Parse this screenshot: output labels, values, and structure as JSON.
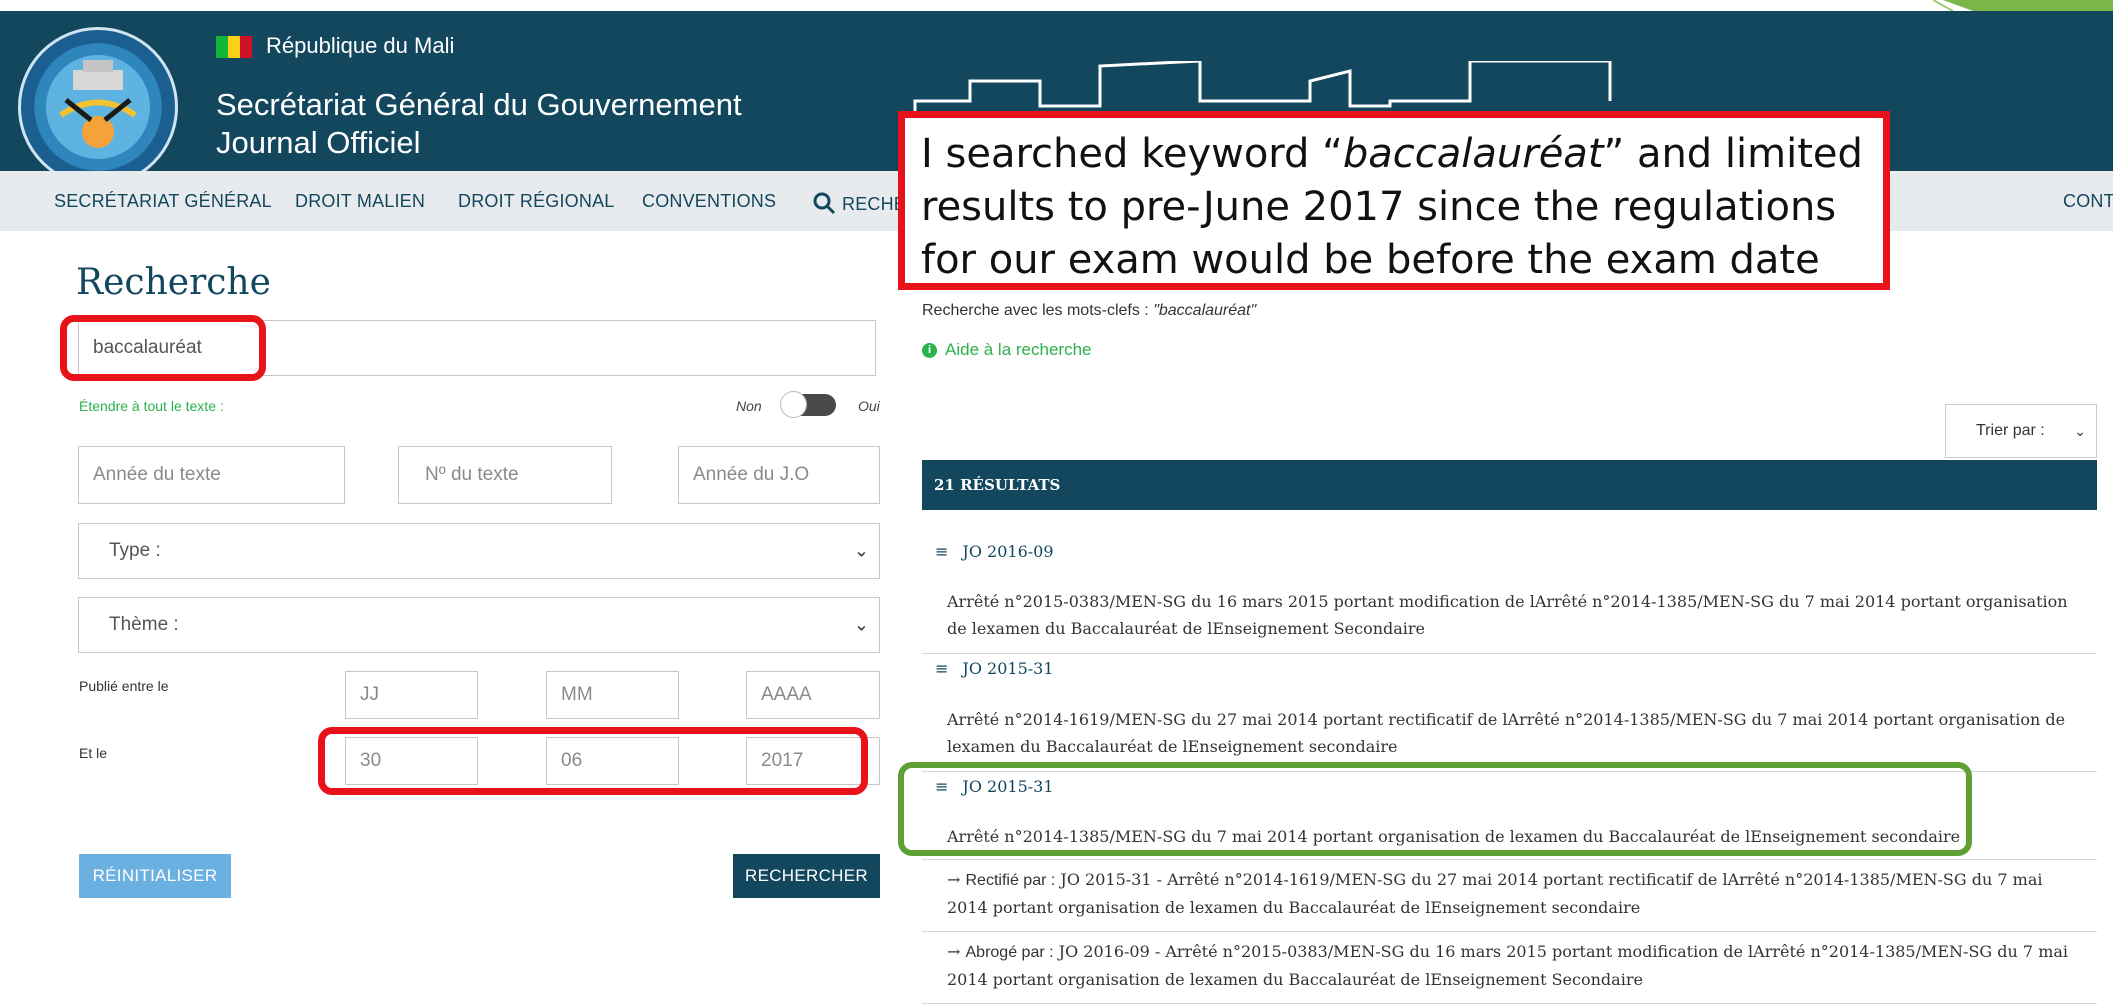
{
  "header": {
    "country": "République du Mali",
    "sgg": "Secrétariat Général du Gouvernement",
    "journal": "Journal Officiel",
    "flag_colors": [
      "#14b53a",
      "#fcd116",
      "#ce1126"
    ]
  },
  "nav": {
    "items": [
      "SECRÉTARIAT GÉNÉRAL",
      "DROIT MALIEN",
      "DROIT RÉGIONAL",
      "CONVENTIONS",
      "RECHE",
      "CONT"
    ],
    "search_icon": "search-icon"
  },
  "search": {
    "title": "Recherche",
    "keyword": "baccalauréat",
    "extend_label": "Étendre à tout le texte :",
    "toggle_off": "Non",
    "toggle_on": "Oui",
    "year_text_placeholder": "Année du texte",
    "num_text_placeholder": "Nº du texte",
    "year_jo_placeholder": "Année du J.O",
    "type_label": "Type :",
    "theme_label": "Thème :",
    "published_between": "Publié entre le",
    "and_label": "Et le",
    "day_placeholder": "JJ",
    "month_placeholder": "MM",
    "year_placeholder": "AAAA",
    "end_day": "30",
    "end_month": "06",
    "end_year": "2017",
    "reset_label": "RÉINITIALISER",
    "search_label": "RECHERCHER"
  },
  "callout": {
    "text_before": "I searched keyword “",
    "text_italic": "baccalauréat",
    "text_after": "” and limited results to pre-June 2017 since the regulations for our exam would be before the exam date"
  },
  "results": {
    "query_label": "Recherche avec les mots-clefs :",
    "query_value": "\"baccalauréat\"",
    "help_label": "Aide à la recherche",
    "sort_label": "Trier par :",
    "count_label": "21 RÉSULTATS",
    "items": [
      {
        "jo": "JO 2016-09",
        "text": "Arrêté n°2015-0383/MEN-SG du 16 mars 2015 portant modification de lArrêté n°2014-1385/MEN-SG du 7 mai 2014 portant organisation de lexamen du Baccalauréat de lEnseignement Secondaire"
      },
      {
        "jo": "JO 2015-31",
        "text": "Arrêté n°2014-1619/MEN-SG du 27 mai 2014 portant rectificatif de lArrêté n°2014-1385/MEN-SG du 7 mai 2014 portant organisation de lexamen du Baccalauréat de lEnseignement secondaire"
      },
      {
        "jo": "JO 2015-31",
        "text": "Arrêté n°2014-1385/MEN-SG du 7 mai 2014 portant organisation de lexamen du Baccalauréat de lEnseignement secondaire"
      }
    ],
    "relations": [
      {
        "label": "Rectifié par :",
        "text": "JO 2015-31 - Arrêté n°2014-1619/MEN-SG du 27 mai 2014 portant rectificatif de lArrêté n°2014-1385/MEN-SG du 7 mai 2014 portant organisation de lexamen du Baccalauréat de lEnseignement secondaire"
      },
      {
        "label": "Abrogé par :",
        "text": "JO 2016-09 - Arrêté n°2015-0383/MEN-SG du 16 mars 2015 portant modification de lArrêté n°2014-1385/MEN-SG du 7 mai 2014 portant organisation de lexamen du Baccalauréat de lEnseignement Secondaire"
      }
    ]
  },
  "colors": {
    "brand": "#13475e",
    "highlight_red": "#e8131a",
    "highlight_green": "#5fa034",
    "link_green": "#2bb24c",
    "reset_button": "#6ab0e0"
  }
}
